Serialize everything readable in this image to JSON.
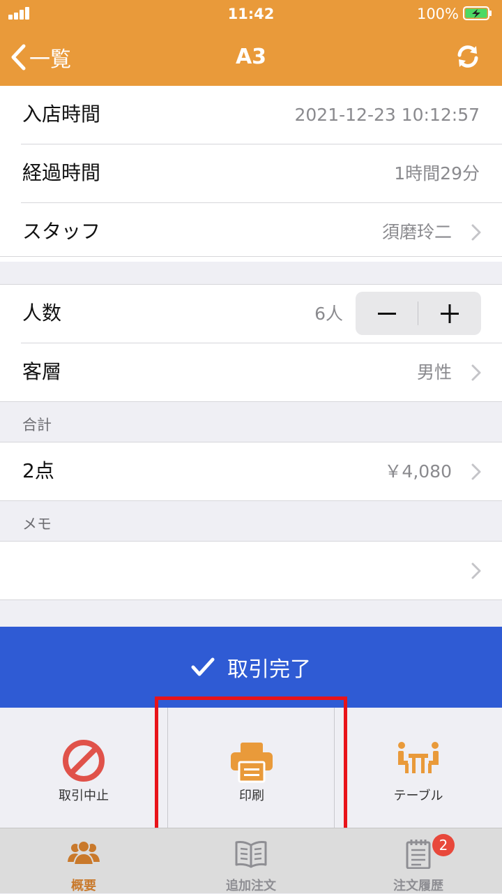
{
  "status_bar": {
    "time": "11:42",
    "battery": "100%"
  },
  "nav": {
    "back_label": "一覧",
    "title": "A3"
  },
  "rows": {
    "entry_time": {
      "label": "入店時間",
      "value": "2021-12-23 10:12:57"
    },
    "elapsed": {
      "label": "経過時間",
      "value": "1時間29分"
    },
    "staff": {
      "label": "スタッフ",
      "value": "須磨玲二"
    },
    "guests": {
      "label": "人数",
      "value": "6人"
    },
    "customer": {
      "label": "客層",
      "value": "男性"
    }
  },
  "total_section": {
    "header": "合計",
    "count": "2点",
    "amount": "￥4,080"
  },
  "memo_section": {
    "header": "メモ",
    "value": ""
  },
  "complete_button": {
    "label": "取引完了"
  },
  "actions": {
    "cancel": "取引中止",
    "print": "印刷",
    "table": "テーブル"
  },
  "tabs": [
    {
      "label": "概要"
    },
    {
      "label": "追加注文"
    },
    {
      "label": "注文履歴",
      "badge": "2"
    }
  ],
  "colors": {
    "header": "#e99a3a",
    "complete": "#2f5bd4",
    "cancel": "#e0524a",
    "highlight": "#e8131a"
  }
}
